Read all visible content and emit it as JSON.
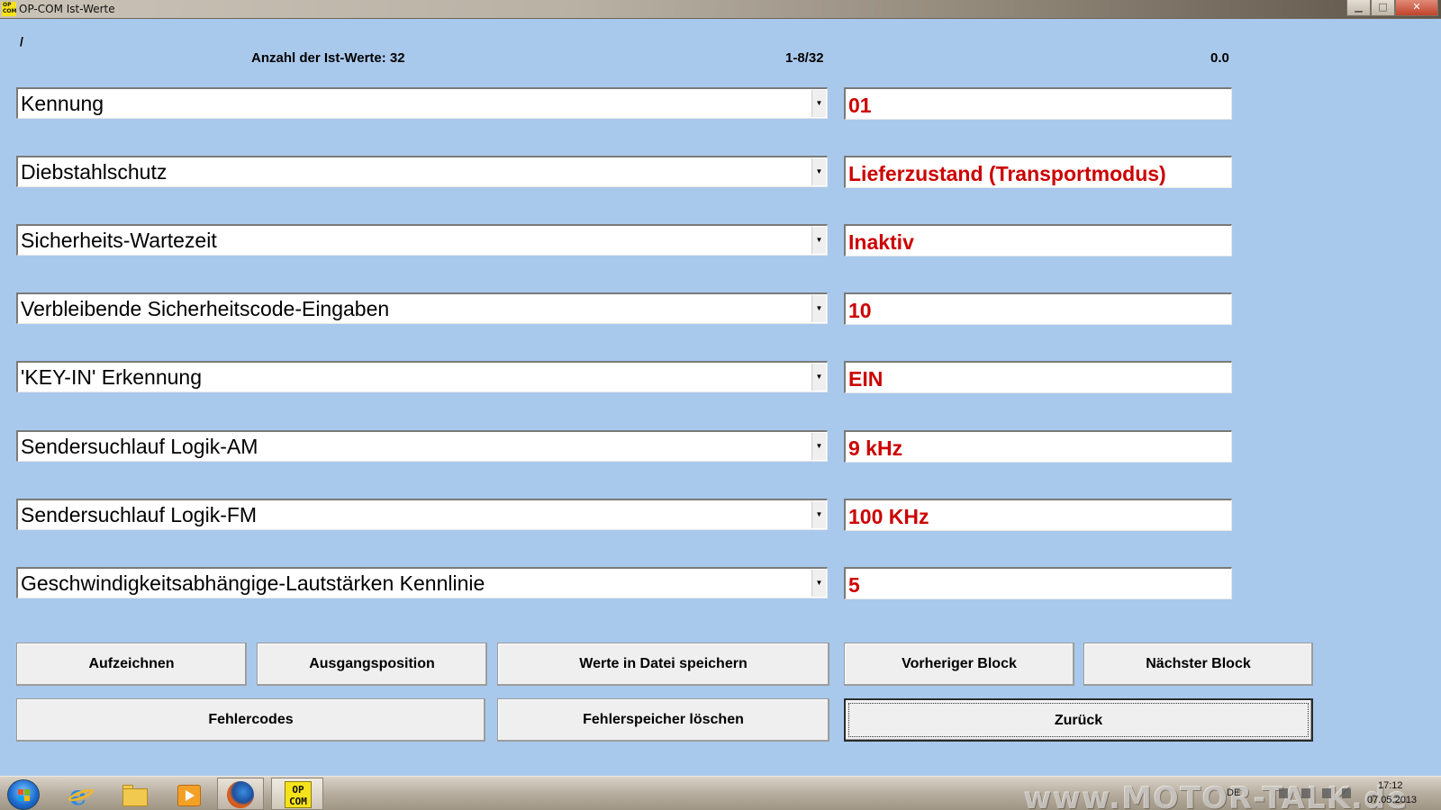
{
  "window": {
    "title": "OP-COM Ist-Werte",
    "icon_text": "OP COM",
    "controls": {
      "minimize": "▁",
      "maximize": "□",
      "close": "✕"
    }
  },
  "header": {
    "path": "/",
    "count_label": "Anzahl der Ist-Werte: 32",
    "range": "1-8/32",
    "value": "0.0"
  },
  "rows": [
    {
      "label": "Kennung",
      "value": "01"
    },
    {
      "label": "Diebstahlschutz",
      "value": "Lieferzustand (Transportmodus)"
    },
    {
      "label": "Sicherheits-Wartezeit",
      "value": "Inaktiv"
    },
    {
      "label": "Verbleibende Sicherheitscode-Eingaben",
      "value": "10"
    },
    {
      "label": "'KEY-IN' Erkennung",
      "value": "EIN"
    },
    {
      "label": "Sendersuchlauf Logik-AM",
      "value": "9 kHz"
    },
    {
      "label": "Sendersuchlauf Logik-FM",
      "value": "100 KHz"
    },
    {
      "label": "Geschwindigkeitsabhängige-Lautstärken Kennlinie",
      "value": "5"
    }
  ],
  "buttons": {
    "record": "Aufzeichnen",
    "home_position": "Ausgangsposition",
    "save_to_file": "Werte in Datei speichern",
    "previous_block": "Vorheriger Block",
    "next_block": "Nächster Block",
    "error_codes": "Fehlercodes",
    "clear_error_memory": "Fehlerspeicher löschen",
    "back": "Zurück"
  },
  "taskbar": {
    "apps": [
      "start-icon",
      "internet-explorer-icon",
      "folder-icon",
      "media-player-icon",
      "firefox-icon",
      "opcom-icon"
    ],
    "opcom_label": "OP COM",
    "watermark": "www.MOTOR-TALK.de",
    "language": "DE",
    "time": "17:12",
    "date": "07.05.2013"
  },
  "colors": {
    "background": "#a9c9ec",
    "value_text": "#cc0000"
  }
}
